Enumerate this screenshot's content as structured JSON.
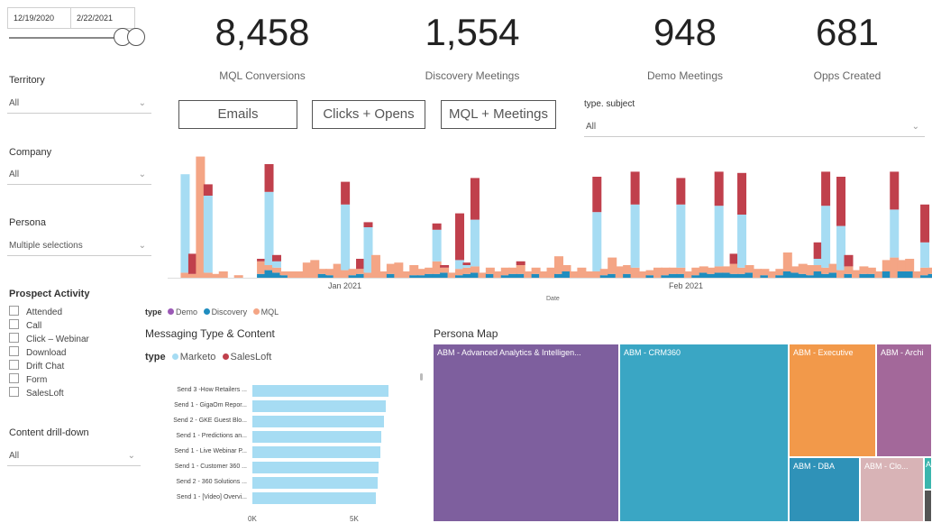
{
  "filters": {
    "date_start": "12/19/2020",
    "date_end": "2/22/2021",
    "territory": {
      "label": "Territory",
      "value": "All"
    },
    "company": {
      "label": "Company",
      "value": "All"
    },
    "persona": {
      "label": "Persona",
      "value": "Multiple selections"
    },
    "content": {
      "label": "Content drill-down",
      "value": "All"
    },
    "type_subject": {
      "label": "type. subject",
      "value": "All"
    }
  },
  "kpis": [
    {
      "value": "8,458",
      "label": "MQL Conversions"
    },
    {
      "value": "1,554",
      "label": "Discovery Meetings"
    },
    {
      "value": "948",
      "label": "Demo Meetings"
    },
    {
      "value": "681",
      "label": "Opps Created"
    }
  ],
  "toggles": {
    "emails": "Emails",
    "clicks": "Clicks + Opens",
    "mql": "MQL + Meetings"
  },
  "prospect_activity": {
    "title": "Prospect Activity",
    "items": [
      "Attended",
      "Call",
      "Click – Webinar",
      "Download",
      "Drift Chat",
      "Form",
      "SalesLoft"
    ]
  },
  "colors": {
    "demo": "#c0404c",
    "discovery": "#a6dcf3",
    "mql": "#f4a585",
    "dark_blue": "#1f8dbf",
    "purple": "#7e5f9e",
    "teal": "#3aa6c4",
    "orange": "#f2994a",
    "pink": "#c9a0a8"
  },
  "chart_data": [
    {
      "type": "bar",
      "stacked": true,
      "xlabel": "Date",
      "x_ticks": [
        "Jan 2021",
        "Feb 2021"
      ],
      "legend": {
        "title": "type",
        "entries": [
          "Demo",
          "Discovery",
          "MQL"
        ]
      },
      "series": [
        {
          "name": "Demo",
          "values": [
            0,
            0,
            0.16,
            0,
            0.09,
            0,
            0,
            0,
            0,
            0,
            0,
            0.02,
            0.22,
            0.05,
            0,
            0,
            0,
            0,
            0,
            0,
            0,
            0,
            0.18,
            0,
            0.08,
            0.04,
            0,
            0,
            0,
            0,
            0,
            0,
            0,
            0,
            0.05,
            0.02,
            0,
            0.37,
            0.02,
            0.33,
            0,
            0,
            0,
            0,
            0,
            0.03,
            0,
            0,
            0,
            0,
            0,
            0,
            0,
            0,
            0,
            0.28,
            0,
            0,
            0,
            0,
            0.26,
            0,
            0,
            0,
            0,
            0,
            0.21,
            0,
            0,
            0,
            0,
            0.27,
            0,
            0.08,
            0.33,
            0,
            0,
            0,
            0,
            0,
            0,
            0,
            0,
            0,
            0.13,
            0.27,
            0,
            0.39,
            0.09,
            0,
            0,
            0,
            0,
            0,
            0.3,
            0,
            0,
            0,
            0.3,
            0,
            0.09
          ]
        },
        {
          "name": "Discovery",
          "values": [
            0,
            0.78,
            0,
            0,
            0.61,
            0,
            0,
            0,
            0,
            0,
            0,
            0,
            0.58,
            0.05,
            0,
            0,
            0,
            0,
            0,
            0,
            0,
            0,
            0.52,
            0,
            0,
            0.36,
            0,
            0,
            0,
            0,
            0,
            0,
            0,
            0,
            0.25,
            0,
            0,
            0.07,
            0.02,
            0.37,
            0,
            0,
            0,
            0,
            0,
            0,
            0,
            0,
            0,
            0,
            0,
            0,
            0,
            0,
            0,
            0.47,
            0,
            0,
            0,
            0,
            0.5,
            0,
            0,
            0,
            0,
            0,
            0.5,
            0,
            0,
            0,
            0,
            0.48,
            0,
            0,
            0.42,
            0,
            0,
            0,
            0,
            0,
            0,
            0,
            0,
            0,
            0.05,
            0.49,
            0,
            0.35,
            0,
            0,
            0,
            0,
            0,
            0,
            0.38,
            0,
            0,
            0,
            0.2,
            0,
            0
          ]
        },
        {
          "name": "MQL",
          "values": [
            0,
            0.04,
            0.03,
            0.96,
            0.04,
            0.03,
            0.05,
            0,
            0.02,
            0,
            0,
            0.1,
            0.04,
            0.04,
            0.03,
            0.05,
            0.05,
            0.12,
            0.14,
            0.04,
            0.05,
            0.11,
            0.06,
            0.05,
            0.04,
            0.04,
            0.18,
            0.05,
            0.08,
            0.12,
            0.05,
            0.08,
            0.05,
            0.05,
            0.1,
            0.04,
            0.04,
            0.05,
            0.05,
            0.05,
            0.04,
            0.05,
            0.05,
            0.06,
            0.05,
            0.07,
            0.05,
            0.05,
            0.05,
            0.08,
            0.14,
            0.05,
            0.05,
            0.08,
            0.05,
            0.05,
            0.05,
            0.13,
            0.09,
            0.07,
            0.08,
            0.05,
            0.04,
            0.08,
            0.06,
            0.05,
            0.05,
            0.05,
            0.06,
            0.05,
            0.05,
            0.05,
            0.05,
            0.08,
            0.05,
            0.06,
            0.07,
            0.05,
            0.05,
            0.05,
            0.15,
            0.05,
            0.08,
            0.08,
            0.05,
            0.05,
            0.07,
            0.06,
            0.06,
            0.06,
            0.06,
            0.05,
            0.05,
            0.09,
            0.16,
            0.09,
            0.1,
            0.05,
            0.06,
            0.05,
            0.05,
            0.06
          ]
        },
        {
          "name": "Dark",
          "values": [
            0,
            0,
            0,
            0,
            0,
            0,
            0,
            0,
            0,
            0,
            0,
            0.03,
            0.06,
            0.04,
            0.02,
            0,
            0,
            0,
            0,
            0.03,
            0.02,
            0,
            0,
            0.02,
            0.03,
            0,
            0,
            0,
            0.03,
            0,
            0,
            0.02,
            0.02,
            0.03,
            0.03,
            0.04,
            0,
            0.02,
            0.03,
            0.04,
            0,
            0.03,
            0,
            0.02,
            0.03,
            0.03,
            0,
            0.03,
            0,
            0,
            0.03,
            0.05,
            0,
            0,
            0,
            0,
            0.02,
            0.03,
            0,
            0.03,
            0,
            0,
            0.02,
            0,
            0.02,
            0.03,
            0.03,
            0,
            0.02,
            0.04,
            0.03,
            0.04,
            0.04,
            0.03,
            0.03,
            0.04,
            0,
            0.02,
            0,
            0.02,
            0.05,
            0.04,
            0.03,
            0.02,
            0.05,
            0.03,
            0.04,
            0,
            0.03,
            0,
            0.03,
            0.03,
            0,
            0.05,
            0,
            0.05,
            0.05,
            0,
            0.02,
            0.03,
            0.03,
            0.02
          ]
        }
      ]
    },
    {
      "type": "bar",
      "orientation": "horizontal",
      "title": "Messaging Type & Content",
      "legend": {
        "title": "type",
        "entries": [
          "Marketo",
          "SalesLoft"
        ]
      },
      "categories": [
        "Send 3 -How Retailers ...",
        "Send 1 - GigaOm Repor...",
        "Send 2 - GKE Guest Blo...",
        "Send 1 - Predictions an...",
        "Send 1 - Live Webinar P...",
        "Send 1 - Customer 360 ...",
        "Send 2 - 360 Solutions ...",
        "Send 1 - [Video] Overvi..."
      ],
      "values": [
        6200,
        6100,
        6000,
        5900,
        5850,
        5750,
        5700,
        5650
      ],
      "x_ticks": [
        "0K",
        "5K"
      ],
      "xlim": [
        0,
        6500
      ]
    },
    {
      "type": "treemap",
      "title": "Persona Map",
      "items": [
        {
          "name": "ABM - Advanced Analytics & Intelligen...",
          "color": "#7e5f9e"
        },
        {
          "name": "ABM - CRM360",
          "color": "#3aa6c4"
        },
        {
          "name": "ABM - Executive",
          "color": "#f2994a"
        },
        {
          "name": "ABM - Archi",
          "color": "#a3689a"
        },
        {
          "name": "ABM - DBA",
          "color": "#2f92b8"
        },
        {
          "name": "ABM - Clo...",
          "color": "#d8b3b6"
        },
        {
          "name": "A",
          "color": "#3bb5ad"
        }
      ]
    }
  ]
}
